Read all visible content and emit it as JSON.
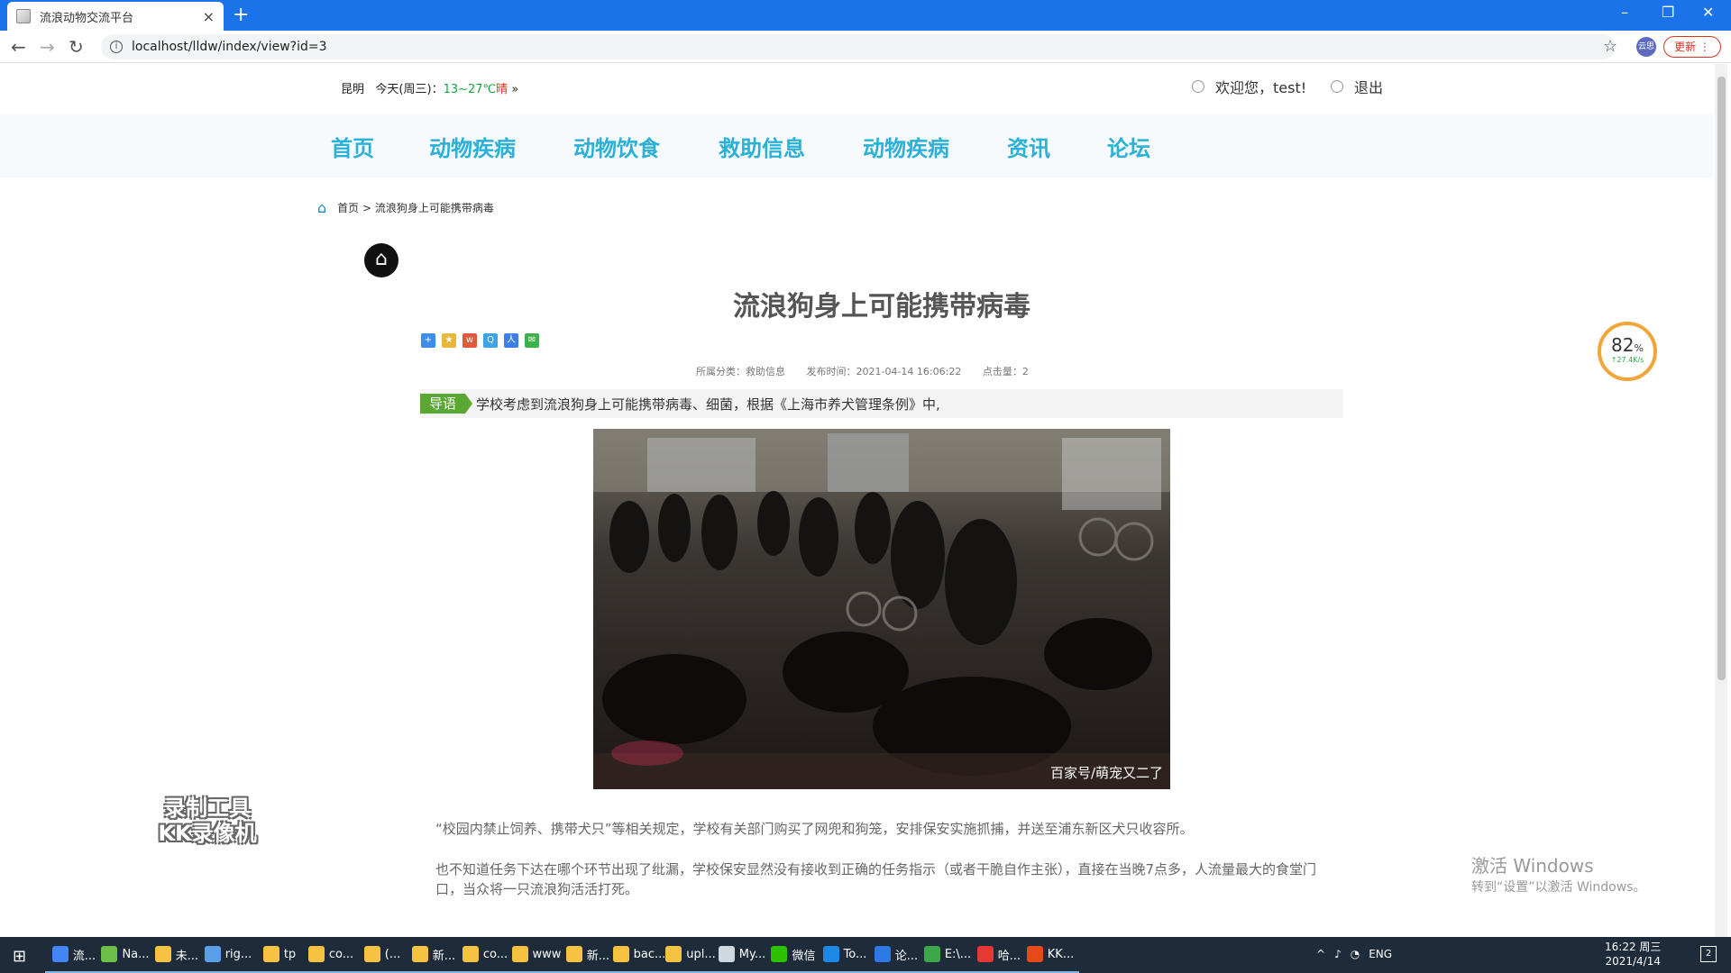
{
  "browser": {
    "tab_title": "流浪动物交流平台",
    "tab_close": "×",
    "new_tab": "+",
    "url": "localhost/lldw/index/view?id=3",
    "update_label": "更新",
    "profile_label": "云思",
    "window_controls": [
      "–",
      "❐",
      "✕"
    ]
  },
  "header": {
    "city": "昆明",
    "today": "今天(周三)：",
    "temp": "13~27℃",
    "condition": "晴",
    "more": "»",
    "welcome": "欢迎您，test!",
    "logout": "退出"
  },
  "nav": {
    "items": [
      {
        "label": "首页"
      },
      {
        "label": "动物疾病"
      },
      {
        "label": "动物饮食"
      },
      {
        "label": "救助信息"
      },
      {
        "label": "动物疾病"
      },
      {
        "label": "资讯"
      },
      {
        "label": "论坛"
      }
    ]
  },
  "breadcrumb": {
    "home": "首页",
    "separator": ">",
    "current": "流浪狗身上可能携带病毒"
  },
  "article": {
    "title": "流浪狗身上可能携带病毒",
    "category": "所属分类：救助信息",
    "published": "发布时间：2021-04-14 16:06:22",
    "views": "点击量：2",
    "lead_tag": "导语",
    "lead_text": "学校考虑到流浪狗身上可能携带病毒、细菌，根据《上海市养犬管理条例》中,",
    "image_caption": "百家号/萌宠又二了",
    "paragraphs": [
      "“校园内禁止饲养、携带犬只”等相关规定，学校有关部门购买了网兜和狗笼，安排保安实施抓捕，并送至浦东新区犬只收容所。",
      "也不知道任务下达在哪个环节出现了纰漏，学校保安显然没有接收到正确的任务指示（或者干脆自作主张），直接在当晚7点多，人流量最大的食堂门口，当众将一只流浪狗活活打死。"
    ]
  },
  "overlays": {
    "rec_tool_line1": "录制工具",
    "rec_tool_line2": "KK录像机",
    "speed_pct": "82",
    "speed_unit": "%",
    "speed_rate": "↑27.4K/s",
    "activate_title": "激活 Windows",
    "activate_sub": "转到“设置”以激活 Windows。"
  },
  "taskbar": {
    "tasks": [
      {
        "label": "流...",
        "color": "#4285f4"
      },
      {
        "label": "Na...",
        "color": "#6cc04a"
      },
      {
        "label": "未...",
        "color": "#f5c242"
      },
      {
        "label": "rig...",
        "color": "#5aa0e8"
      },
      {
        "label": "tp",
        "color": "#f5c242"
      },
      {
        "label": "co...",
        "color": "#f5c242"
      },
      {
        "label": "(...",
        "color": "#f5c242"
      },
      {
        "label": "新...",
        "color": "#f5c242"
      },
      {
        "label": "co...",
        "color": "#f5c242"
      },
      {
        "label": "www",
        "color": "#f5c242"
      },
      {
        "label": "新...",
        "color": "#f5c242"
      },
      {
        "label": "bac...",
        "color": "#f5c242"
      },
      {
        "label": "upl...",
        "color": "#f5c242"
      },
      {
        "label": "My...",
        "color": "#cfd8dc"
      },
      {
        "label": "微信",
        "color": "#2dc100"
      },
      {
        "label": "To...",
        "color": "#1e88e5"
      },
      {
        "label": "论...",
        "color": "#2c7be5"
      },
      {
        "label": "E:\\...",
        "color": "#3ea64a"
      },
      {
        "label": "哈...",
        "color": "#e53935"
      },
      {
        "label": "KK...",
        "color": "#e64a19"
      }
    ],
    "lang": "ENG",
    "time": "16:22 周三",
    "date": "2021/4/14",
    "notify_count": "2"
  },
  "colors": {
    "chrome_blue": "#1a73e8",
    "nav_text": "#2bb0d8",
    "lead_green": "#5aa832",
    "taskbar": "#1d2b3a"
  }
}
